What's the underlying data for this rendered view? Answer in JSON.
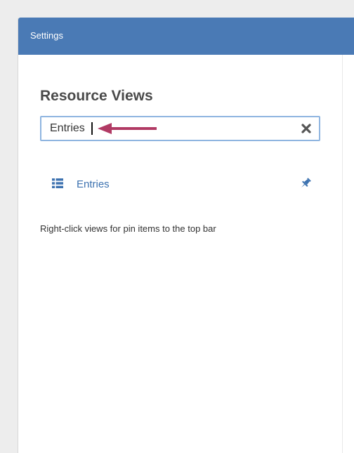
{
  "header": {
    "title": "Settings"
  },
  "section": {
    "title": "Resource Views"
  },
  "search": {
    "value": "Entries",
    "clear_icon": "close-icon"
  },
  "views": [
    {
      "label": "Entries",
      "icon": "list-icon",
      "pin_icon": "pin-icon"
    }
  ],
  "hint": {
    "text": "Right-click views for pin items to the top bar"
  },
  "colors": {
    "header_bg": "#4a7ab5",
    "link": "#3d72b0",
    "arrow": "#b13a64",
    "input_border": "#8fb5e0"
  }
}
